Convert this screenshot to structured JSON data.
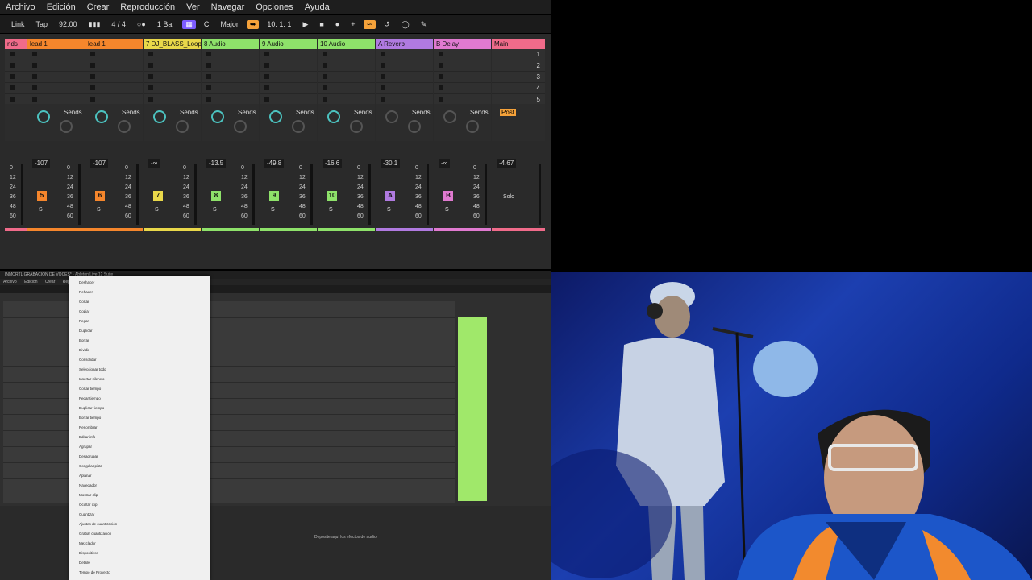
{
  "menubar": [
    "Archivo",
    "Edición",
    "Crear",
    "Reproducción",
    "Ver",
    "Navegar",
    "Opciones",
    "Ayuda"
  ],
  "transport": {
    "link": "Link",
    "tap": "Tap",
    "tempo": "92.00",
    "sig": "4 / 4",
    "bar": "1 Bar",
    "key": "C",
    "scale": "Major",
    "position": "10.   1.   1"
  },
  "tracks": [
    {
      "name": "nds",
      "color": "#f06b8a",
      "num": "",
      "vol": ""
    },
    {
      "name": "lead 1",
      "color": "#f5862c",
      "num": "5",
      "vol": "-107"
    },
    {
      "name": "lead 1",
      "color": "#f5862c",
      "num": "6",
      "vol": "-107"
    },
    {
      "name": "7 DJ_BLASS_Loop",
      "color": "#e9d84a",
      "num": "7",
      "vol": "-∞"
    },
    {
      "name": "8 Audio",
      "color": "#8ee26a",
      "num": "8",
      "vol": "-13.5"
    },
    {
      "name": "9 Audio",
      "color": "#8ee26a",
      "num": "9",
      "vol": "-49.8"
    },
    {
      "name": "10 Audio",
      "color": "#8ee26a",
      "num": "10",
      "vol": "-16.6"
    },
    {
      "name": "A Reverb",
      "color": "#b07ae0",
      "num": "A",
      "vol": "-30.1"
    },
    {
      "name": "B Delay",
      "color": "#e07ad0",
      "num": "B",
      "vol": "-∞"
    },
    {
      "name": "Main",
      "color": "#f06b8a",
      "num": "",
      "vol": "-4.67"
    }
  ],
  "sends_label": "Sends",
  "post": "Post",
  "scenes": [
    "1",
    "2",
    "3",
    "4",
    "5"
  ],
  "scale": [
    "0",
    "12",
    "24",
    "36",
    "48",
    "60"
  ],
  "solo": "Solo",
  "win2": {
    "title": "INMORTL GRABACION DE VOCES* - Ableton Live 12 Suite",
    "menu": [
      "Archivo",
      "Edición",
      "Crear",
      "Reproducción"
    ],
    "drop": "Deposite aquí los efectos de audio"
  },
  "dropmenu": [
    "Deshacer",
    "Rehacer",
    "Cortar",
    "Copiar",
    "Pegar",
    "Duplicar",
    "Borrar",
    "Dividir",
    "Consolidar",
    "Seleccionar todo",
    "Insertar silencio",
    "Cortar tiempo",
    "Pegar tiempo",
    "Duplicar tiempo",
    "Borrar tiempo",
    "Renombrar",
    "Editar info",
    "Agrupar",
    "Desagrupar",
    "Congelar pista",
    "Aplanar",
    "Navegador",
    "Mostrar clip",
    "Ocultar clip",
    "Cuantizar",
    "Ajustes de cuantización",
    "Grabar cuantización",
    "Mezclador",
    "Dispositivos",
    "Detalle",
    "Tempo de Proyecto"
  ]
}
